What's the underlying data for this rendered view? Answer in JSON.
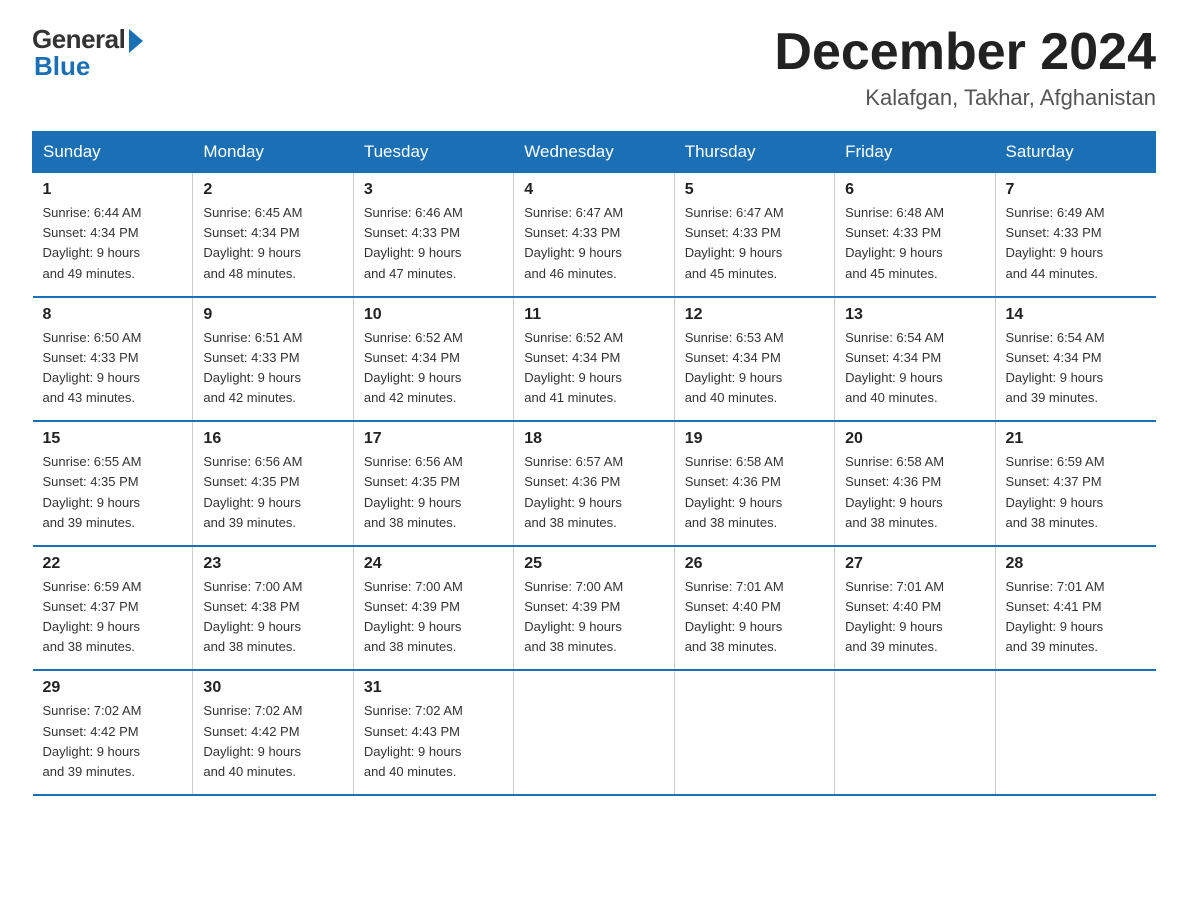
{
  "header": {
    "logo_general": "General",
    "logo_blue": "Blue",
    "month_title": "December 2024",
    "location": "Kalafgan, Takhar, Afghanistan"
  },
  "days_of_week": [
    "Sunday",
    "Monday",
    "Tuesday",
    "Wednesday",
    "Thursday",
    "Friday",
    "Saturday"
  ],
  "weeks": [
    [
      {
        "day": "1",
        "sunrise": "6:44 AM",
        "sunset": "4:34 PM",
        "daylight": "9 hours and 49 minutes."
      },
      {
        "day": "2",
        "sunrise": "6:45 AM",
        "sunset": "4:34 PM",
        "daylight": "9 hours and 48 minutes."
      },
      {
        "day": "3",
        "sunrise": "6:46 AM",
        "sunset": "4:33 PM",
        "daylight": "9 hours and 47 minutes."
      },
      {
        "day": "4",
        "sunrise": "6:47 AM",
        "sunset": "4:33 PM",
        "daylight": "9 hours and 46 minutes."
      },
      {
        "day": "5",
        "sunrise": "6:47 AM",
        "sunset": "4:33 PM",
        "daylight": "9 hours and 45 minutes."
      },
      {
        "day": "6",
        "sunrise": "6:48 AM",
        "sunset": "4:33 PM",
        "daylight": "9 hours and 45 minutes."
      },
      {
        "day": "7",
        "sunrise": "6:49 AM",
        "sunset": "4:33 PM",
        "daylight": "9 hours and 44 minutes."
      }
    ],
    [
      {
        "day": "8",
        "sunrise": "6:50 AM",
        "sunset": "4:33 PM",
        "daylight": "9 hours and 43 minutes."
      },
      {
        "day": "9",
        "sunrise": "6:51 AM",
        "sunset": "4:33 PM",
        "daylight": "9 hours and 42 minutes."
      },
      {
        "day": "10",
        "sunrise": "6:52 AM",
        "sunset": "4:34 PM",
        "daylight": "9 hours and 42 minutes."
      },
      {
        "day": "11",
        "sunrise": "6:52 AM",
        "sunset": "4:34 PM",
        "daylight": "9 hours and 41 minutes."
      },
      {
        "day": "12",
        "sunrise": "6:53 AM",
        "sunset": "4:34 PM",
        "daylight": "9 hours and 40 minutes."
      },
      {
        "day": "13",
        "sunrise": "6:54 AM",
        "sunset": "4:34 PM",
        "daylight": "9 hours and 40 minutes."
      },
      {
        "day": "14",
        "sunrise": "6:54 AM",
        "sunset": "4:34 PM",
        "daylight": "9 hours and 39 minutes."
      }
    ],
    [
      {
        "day": "15",
        "sunrise": "6:55 AM",
        "sunset": "4:35 PM",
        "daylight": "9 hours and 39 minutes."
      },
      {
        "day": "16",
        "sunrise": "6:56 AM",
        "sunset": "4:35 PM",
        "daylight": "9 hours and 39 minutes."
      },
      {
        "day": "17",
        "sunrise": "6:56 AM",
        "sunset": "4:35 PM",
        "daylight": "9 hours and 38 minutes."
      },
      {
        "day": "18",
        "sunrise": "6:57 AM",
        "sunset": "4:36 PM",
        "daylight": "9 hours and 38 minutes."
      },
      {
        "day": "19",
        "sunrise": "6:58 AM",
        "sunset": "4:36 PM",
        "daylight": "9 hours and 38 minutes."
      },
      {
        "day": "20",
        "sunrise": "6:58 AM",
        "sunset": "4:36 PM",
        "daylight": "9 hours and 38 minutes."
      },
      {
        "day": "21",
        "sunrise": "6:59 AM",
        "sunset": "4:37 PM",
        "daylight": "9 hours and 38 minutes."
      }
    ],
    [
      {
        "day": "22",
        "sunrise": "6:59 AM",
        "sunset": "4:37 PM",
        "daylight": "9 hours and 38 minutes."
      },
      {
        "day": "23",
        "sunrise": "7:00 AM",
        "sunset": "4:38 PM",
        "daylight": "9 hours and 38 minutes."
      },
      {
        "day": "24",
        "sunrise": "7:00 AM",
        "sunset": "4:39 PM",
        "daylight": "9 hours and 38 minutes."
      },
      {
        "day": "25",
        "sunrise": "7:00 AM",
        "sunset": "4:39 PM",
        "daylight": "9 hours and 38 minutes."
      },
      {
        "day": "26",
        "sunrise": "7:01 AM",
        "sunset": "4:40 PM",
        "daylight": "9 hours and 38 minutes."
      },
      {
        "day": "27",
        "sunrise": "7:01 AM",
        "sunset": "4:40 PM",
        "daylight": "9 hours and 39 minutes."
      },
      {
        "day": "28",
        "sunrise": "7:01 AM",
        "sunset": "4:41 PM",
        "daylight": "9 hours and 39 minutes."
      }
    ],
    [
      {
        "day": "29",
        "sunrise": "7:02 AM",
        "sunset": "4:42 PM",
        "daylight": "9 hours and 39 minutes."
      },
      {
        "day": "30",
        "sunrise": "7:02 AM",
        "sunset": "4:42 PM",
        "daylight": "9 hours and 40 minutes."
      },
      {
        "day": "31",
        "sunrise": "7:02 AM",
        "sunset": "4:43 PM",
        "daylight": "9 hours and 40 minutes."
      },
      null,
      null,
      null,
      null
    ]
  ],
  "labels": {
    "sunrise": "Sunrise:",
    "sunset": "Sunset:",
    "daylight": "Daylight:"
  }
}
